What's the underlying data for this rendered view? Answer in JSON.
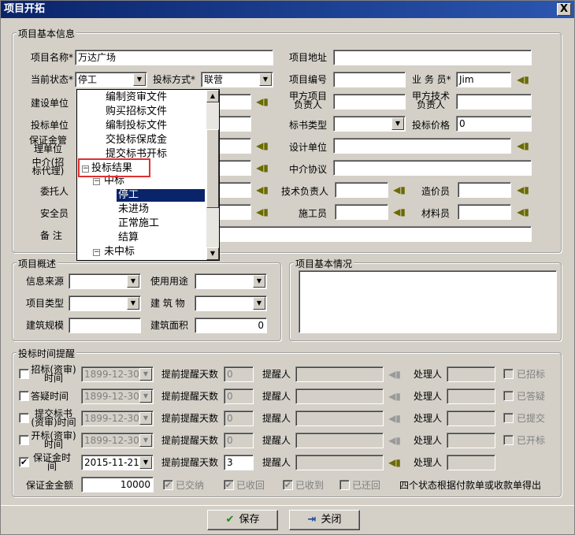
{
  "window": {
    "title": "项目开拓",
    "close": "X"
  },
  "basic": {
    "legend": "项目基本信息",
    "name_label": "项目名称*",
    "name_value": "万达广场",
    "addr_label": "项目地址",
    "addr_value": "",
    "status_label": "当前状态*",
    "status_value": "停工",
    "bidmode_label": "投标方式*",
    "bidmode_value": "联营",
    "code_label": "项目编号",
    "code_value": "",
    "sales_label": "业 务 员*",
    "sales_value": "Jim",
    "build_label": "建设单位",
    "pa_label": "甲方项目负责人",
    "pt_label": "甲方技术负责人",
    "bidunit_label": "投标单位",
    "booktype_label": "标书类型",
    "booktype_value": "",
    "price_label": "投标价格",
    "price_value": "0",
    "deposit_unit_label": "保证金管理单位",
    "design_label": "设计单位",
    "agent_label": "中介(招标代理)",
    "agentdeal_label": "中介协议",
    "client_label": "委托人",
    "techlead_label": "技术负责人",
    "cost_label": "造价员",
    "safety_label": "安全员",
    "constr_label": "施工员",
    "material_label": "材料员",
    "remark_label": "备  注"
  },
  "tree": {
    "items": [
      "编制资审文件",
      "购买招标文件",
      "编制投标文件",
      "交投标保成金",
      "提交标书开标",
      "投标结果",
      "中标",
      "停工",
      "未进场",
      "正常施工",
      "结算",
      "未中标"
    ],
    "selected": "停工"
  },
  "overview": {
    "legend": "项目概述",
    "source_label": "信息来源",
    "use_label": "使用用途",
    "type_label": "项目类型",
    "building_label": "建 筑 物",
    "scale_label": "建筑规模",
    "area_label": "建筑面积",
    "area_value": "0"
  },
  "situation": {
    "legend": "项目基本情况"
  },
  "reminders": {
    "legend": "投标时间提醒",
    "days_label": "提前提醒天数",
    "reminder_label": "提醒人",
    "handler_label": "处理人",
    "rows": [
      {
        "label": "招标(资审)时间",
        "date": "1899-12-30",
        "days": "0",
        "done": "已招标"
      },
      {
        "label": "答疑时间",
        "date": "1899-12-30",
        "days": "0",
        "done": "已答疑"
      },
      {
        "label": "提交标书(资审)时间",
        "date": "1899-12-30",
        "days": "0",
        "done": "已提交"
      },
      {
        "label": "开标(资审)时间",
        "date": "1899-12-30",
        "days": "0",
        "done": "已开标"
      },
      {
        "label": "保证金时间",
        "date": "2015-11-21",
        "days": "3",
        "done": ""
      }
    ],
    "deposit_label": "保证金金额",
    "deposit_value": "10000",
    "paid": "已交纳",
    "recovered": "已收回",
    "received": "已收到",
    "returned": "已还回",
    "note": "四个状态根据付款单或收款单得出"
  },
  "buttons": {
    "save": "保存",
    "close": "关闭"
  }
}
